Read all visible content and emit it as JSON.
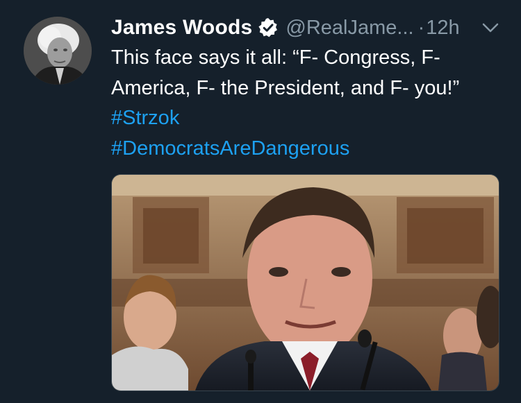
{
  "tweet": {
    "display_name": "James Woods",
    "handle": "@RealJame...",
    "separator": "·",
    "time": "12h",
    "text_plain": "This face says it all: “F- Congress, F- America, F- the President, and F- you!” ",
    "hashtags": [
      "#Strzok",
      "#DemocratsAreDangerous"
    ],
    "verified_icon": "verified-badge-icon",
    "menu_icon": "chevron-down-icon"
  },
  "colors": {
    "background": "#15202b",
    "text": "#ffffff",
    "secondary": "#8899a6",
    "link": "#1da1f2"
  }
}
